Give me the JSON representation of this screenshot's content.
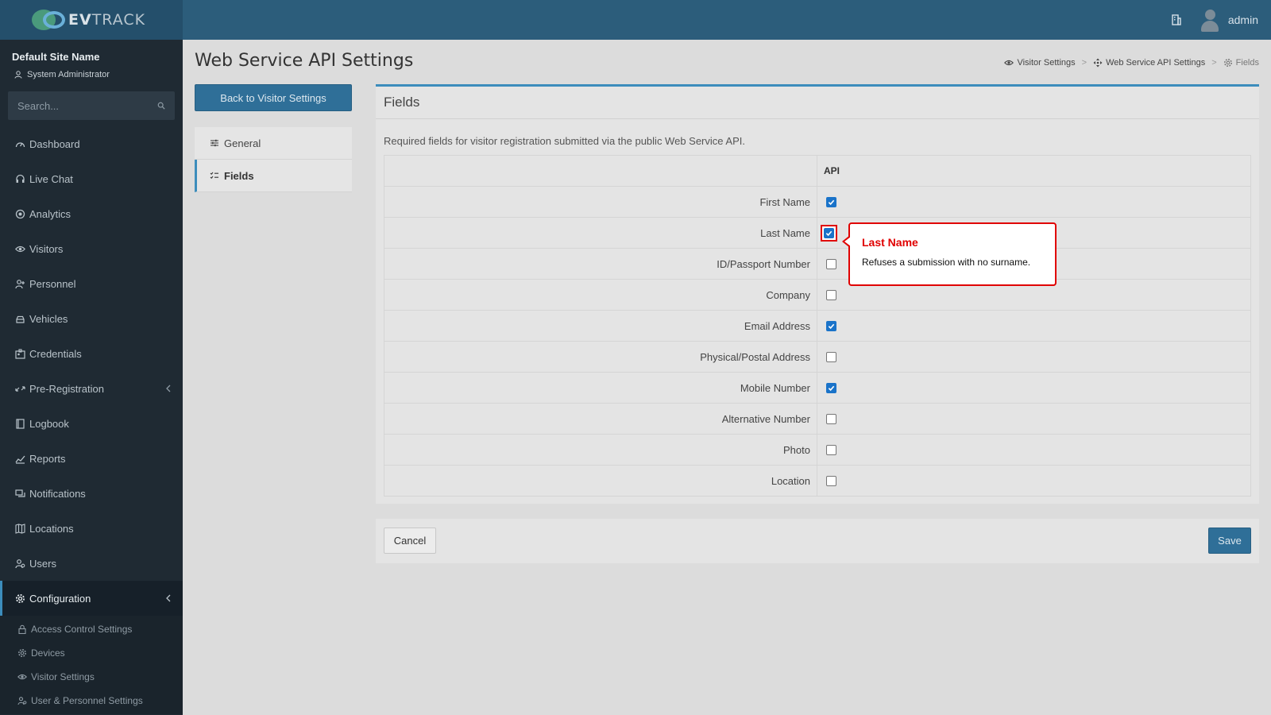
{
  "brand": {
    "prefix": "EV",
    "suffix": "TRACK"
  },
  "topbar": {
    "username": "admin"
  },
  "sidebar": {
    "site_name": "Default Site Name",
    "role": "System Administrator",
    "search_placeholder": "Search...",
    "items": [
      {
        "label": "Dashboard",
        "icon": "dashboard-icon"
      },
      {
        "label": "Live Chat",
        "icon": "headset-icon"
      },
      {
        "label": "Analytics",
        "icon": "target-icon"
      },
      {
        "label": "Visitors",
        "icon": "eye-icon"
      },
      {
        "label": "Personnel",
        "icon": "user-group-icon"
      },
      {
        "label": "Vehicles",
        "icon": "car-icon"
      },
      {
        "label": "Credentials",
        "icon": "id-card-icon"
      },
      {
        "label": "Pre-Registration",
        "icon": "arrows-icon"
      },
      {
        "label": "Logbook",
        "icon": "book-icon"
      },
      {
        "label": "Reports",
        "icon": "chart-icon"
      },
      {
        "label": "Notifications",
        "icon": "chat-icon"
      },
      {
        "label": "Locations",
        "icon": "map-icon"
      },
      {
        "label": "Users",
        "icon": "users-icon"
      },
      {
        "label": "Configuration",
        "icon": "gear-icon"
      }
    ],
    "sub_items": [
      {
        "label": "Access Control Settings",
        "icon": "lock-icon"
      },
      {
        "label": "Devices",
        "icon": "cog-icon"
      },
      {
        "label": "Visitor Settings",
        "icon": "eye-icon"
      },
      {
        "label": "User & Personnel Settings",
        "icon": "users-icon"
      }
    ]
  },
  "page": {
    "title": "Web Service API Settings",
    "breadcrumb": [
      "Visitor Settings",
      "Web Service API Settings",
      "Fields"
    ],
    "back_button": "Back to Visitor Settings",
    "tabs": [
      "General",
      "Fields"
    ]
  },
  "card": {
    "title": "Fields",
    "description": "Required fields for visitor registration submitted via the public Web Service API.",
    "column_header": "API",
    "rows": [
      {
        "label": "First Name",
        "checked": true
      },
      {
        "label": "Last Name",
        "checked": true
      },
      {
        "label": "ID/Passport Number",
        "checked": false
      },
      {
        "label": "Company",
        "checked": false
      },
      {
        "label": "Email Address",
        "checked": true
      },
      {
        "label": "Physical/Postal Address",
        "checked": false
      },
      {
        "label": "Mobile Number",
        "checked": true
      },
      {
        "label": "Alternative Number",
        "checked": false
      },
      {
        "label": "Photo",
        "checked": false
      },
      {
        "label": "Location",
        "checked": false
      }
    ]
  },
  "footer": {
    "cancel": "Cancel",
    "save": "Save"
  },
  "callout": {
    "title": "Last Name",
    "text": "Refuses a submission with no surname."
  },
  "colors": {
    "accent": "#3c8dbc",
    "primary_button": "#2f6f98",
    "highlight": "#e00000",
    "checkbox_on": "#1a73c9"
  }
}
